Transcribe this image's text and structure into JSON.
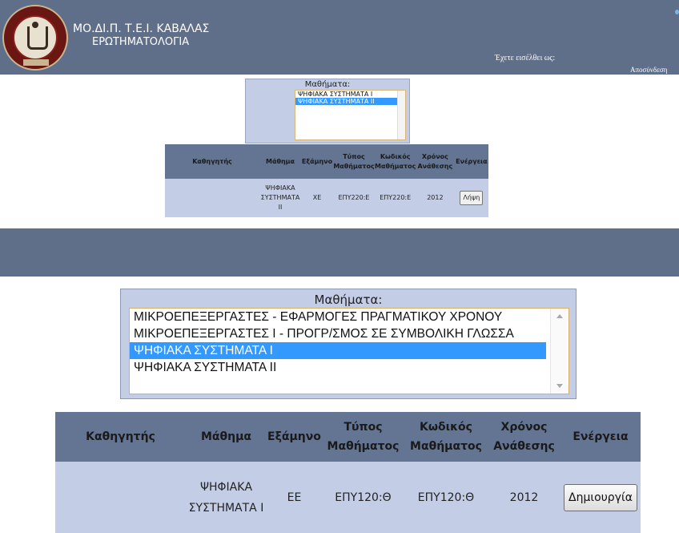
{
  "header": {
    "title": "ΜΟ.ΔΙ.Π. Τ.Ε.Ι. ΚΑΒΑΛΑΣ",
    "subtitle": "ΕΡΩΤΗΜΑΤΟΛΟΓΙΑ",
    "logged_in_label": "Έχετε εισέλθει ως:",
    "logout_label": "Αποσύνδεση",
    "logo_text": "ΤΕΙ ΚΑΒΑΛΑΣ"
  },
  "small_view": {
    "courses_label": "Μαθήματα:",
    "courses": [
      {
        "label": "ΨΗΦΙΑΚΑ ΣΥΣΤΗΜΑΤΑ Ι",
        "selected": false
      },
      {
        "label": "ΨΗΦΙΑΚΑ ΣΥΣΤΗΜΑΤΑ ΙΙ",
        "selected": true
      }
    ],
    "table": {
      "headers": [
        "Καθηγητής",
        "Μάθημα",
        "Εξάμηνο",
        "Τύπος Μαθήματος",
        "Κωδικός Μαθήματος",
        "Χρόνος Ανάθεσης",
        "Ενέργεια"
      ],
      "row": {
        "professor": "",
        "course": "ΨΗΦΙΑΚΑ ΣΥΣΤΗΜΑΤΑ ΙΙ",
        "semester": "ΧΕ",
        "type": "ΕΠΥ220:Ε",
        "code": "ΕΠΥ220:Ε",
        "year": "2012",
        "action": "Λήψη"
      }
    }
  },
  "large_view": {
    "courses_label": "Μαθήματα:",
    "courses": [
      {
        "label": "ΜΙΚΡΟΕΠΕΞΕΡΓΑΣΤΕΣ - ΕΦΑΡΜΟΓΕΣ ΠΡΑΓΜΑΤΙΚΟΥ ΧΡΟΝΟΥ",
        "selected": false
      },
      {
        "label": "ΜΙΚΡΟΕΠΕΞΕΡΓΑΣΤΕΣ Ι - ΠΡΟΓΡ/ΣΜΟΣ ΣΕ ΣΥΜΒΟΛΙΚΗ ΓΛΩΣΣΑ",
        "selected": false
      },
      {
        "label": "ΨΗΦΙΑΚΑ ΣΥΣΤΗΜΑΤΑ Ι",
        "selected": true
      },
      {
        "label": "ΨΗΦΙΑΚΑ ΣΥΣΤΗΜΑΤΑ ΙΙ",
        "selected": false
      }
    ],
    "table": {
      "headers": [
        "Καθηγητής",
        "Μάθημα",
        "Εξάμηνο",
        "Τύπος Μαθήματος",
        "Κωδικός Μαθήματος",
        "Χρόνος Ανάθεσης",
        "Ενέργεια"
      ],
      "row": {
        "professor": "",
        "course": "ΨΗΦΙΑΚΑ ΣΥΣΤΗΜΑΤΑ Ι",
        "semester": "ΕΕ",
        "type": "ΕΠΥ120:Θ",
        "code": "ΕΠΥ120:Θ",
        "year": "2012",
        "action": "Δημιουργία"
      }
    }
  },
  "colors": {
    "header_bg": "#5f6e89",
    "panel_bg": "#c3cee6",
    "table_header_bg": "#637593",
    "selection": "#3399ff"
  }
}
